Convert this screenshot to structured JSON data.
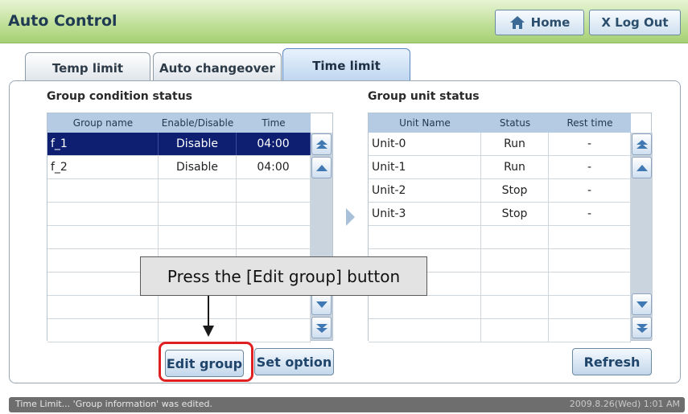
{
  "app": {
    "title": "Auto Control"
  },
  "header": {
    "home_label": "Home",
    "logout_label": "X Log Out"
  },
  "tabs": [
    {
      "label": "Temp limit",
      "active": false
    },
    {
      "label": "Auto changeover",
      "active": false
    },
    {
      "label": "Time limit",
      "active": true
    }
  ],
  "group_condition": {
    "title": "Group condition status",
    "columns": [
      "Group name",
      "Enable/Disable",
      "Time"
    ],
    "rows": [
      {
        "name": "f_1",
        "state": "Disable",
        "time": "04:00",
        "selected": true
      },
      {
        "name": "f_2",
        "state": "Disable",
        "time": "04:00",
        "selected": false
      }
    ]
  },
  "group_unit": {
    "title": "Group unit status",
    "columns": [
      "Unit Name",
      "Status",
      "Rest time"
    ],
    "rows": [
      {
        "name": "Unit-0",
        "status": "Run",
        "rest": "-"
      },
      {
        "name": "Unit-1",
        "status": "Run",
        "rest": "-"
      },
      {
        "name": "Unit-2",
        "status": "Stop",
        "rest": "-"
      },
      {
        "name": "Unit-3",
        "status": "Stop",
        "rest": "-"
      }
    ]
  },
  "buttons": {
    "edit_group": "Edit group",
    "set_option": "Set option",
    "refresh": "Refresh"
  },
  "callout": {
    "text": "Press the [Edit group] button"
  },
  "status_bar": {
    "message": "Time Limit... 'Group information' was edited.",
    "datetime": "2009.8.26(Wed)  1:01 AM"
  },
  "colors": {
    "header_green": "#a6d074",
    "selected_row": "#0e1f72",
    "highlight_red": "#e02020"
  },
  "icons": [
    "home-icon",
    "scroll-top-icon",
    "scroll-up-icon",
    "scroll-down-icon",
    "scroll-bottom-icon",
    "arrow-right-icon"
  ]
}
